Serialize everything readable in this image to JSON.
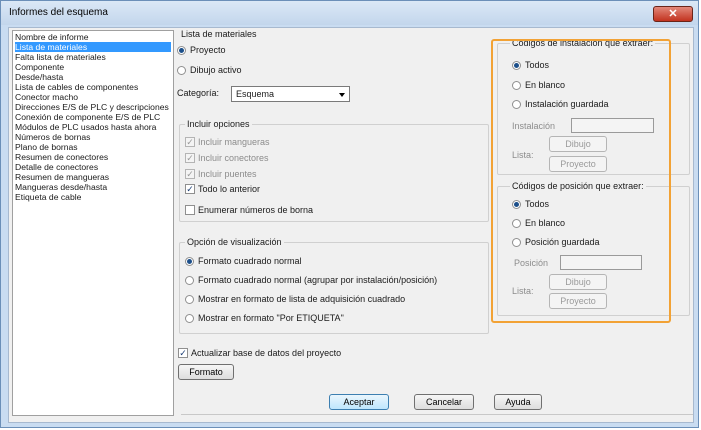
{
  "window": {
    "title": "Informes del esquema",
    "close_glyph": "✕"
  },
  "report_list": {
    "header": "Nombre de informe",
    "items": [
      {
        "label": "Lista de materiales",
        "selected": true
      },
      {
        "label": "Falta lista de materiales"
      },
      {
        "label": "Componente"
      },
      {
        "label": "Desde/hasta"
      },
      {
        "label": "Lista de cables de componentes"
      },
      {
        "label": "Conector macho"
      },
      {
        "label": "Direcciones E/S de PLC y descripciones"
      },
      {
        "label": "Conexión de componente E/S de PLC"
      },
      {
        "label": "Módulos de PLC usados hasta ahora"
      },
      {
        "label": "Números de bornas"
      },
      {
        "label": "Plano de bornas"
      },
      {
        "label": "Resumen de conectores"
      },
      {
        "label": "Detalle de conectores"
      },
      {
        "label": "Resumen de mangueras"
      },
      {
        "label": "Mangueras desde/hasta"
      },
      {
        "label": "Etiqueta de cable"
      }
    ]
  },
  "bom": {
    "title": "Lista de materiales",
    "proyecto": "Proyecto",
    "dibujo_activo": "Dibujo activo",
    "selected_source": "Proyecto",
    "categoria_label": "Categoría:",
    "categoria_value": "Esquema"
  },
  "include": {
    "title": "Incluir opciones",
    "mangueras": "Incluir mangueras",
    "conectores": "Incluir conectores",
    "puentes": "Incluir puentes",
    "todo": "Todo lo anterior",
    "enumerar": "Enumerar números de borna",
    "check": "✓"
  },
  "display": {
    "title": "Opción de visualización",
    "opt1": "Formato cuadrado normal",
    "opt2": "Formato cuadrado normal (agrupar por instalación/posición)",
    "opt3": "Mostrar en formato de lista de adquisición cuadrado",
    "opt4": "Mostrar en formato \"Por ETIQUETA\"",
    "selected": "Formato cuadrado normal"
  },
  "actualizar": "Actualizar base de datos del proyecto",
  "formato_btn": "Formato",
  "install_codes": {
    "title": "Códigos de instalación que extraer:",
    "todos": "Todos",
    "en_blanco": "En blanco",
    "guardada": "Instalación guardada",
    "field_label": "Instalación",
    "lista_label": "Lista:",
    "dibujo_btn": "Dibujo",
    "proyecto_btn": "Proyecto",
    "selected": "Todos"
  },
  "location_codes": {
    "title": "Códigos de posición que extraer:",
    "todos": "Todos",
    "en_blanco": "En blanco",
    "guardada": "Posición guardada",
    "field_label": "Posición",
    "lista_label": "Lista:",
    "dibujo_btn": "Dibujo",
    "proyecto_btn": "Proyecto",
    "selected": "Todos"
  },
  "buttons": {
    "aceptar": "Aceptar",
    "cancelar": "Cancelar",
    "ayuda": "Ayuda"
  },
  "colors": {
    "highlight": "#f2a235",
    "selection": "#3399ff",
    "title_bar": "#c9dcf1"
  }
}
